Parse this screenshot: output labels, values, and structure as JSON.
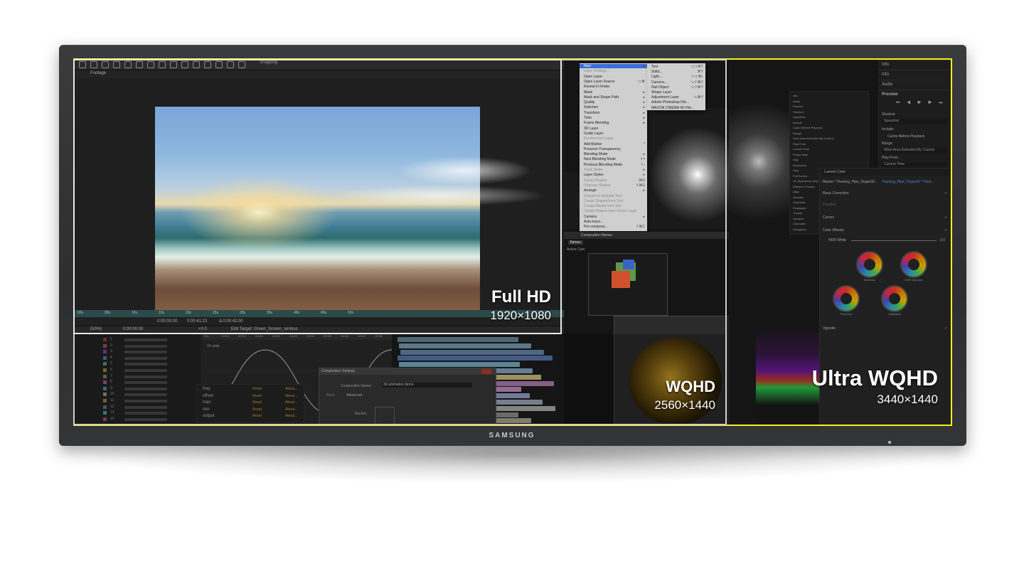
{
  "brand": "SAMSUNG",
  "resolutions": [
    {
      "title": "Full HD",
      "size": "1920×1080",
      "frame_color": "#e8e8e8"
    },
    {
      "title": "WQHD",
      "size": "2560×1440",
      "frame_color": "#cfcfcf"
    },
    {
      "title": "Ultra WQHD",
      "size": "3440×1440",
      "frame_color": "#f3f01e"
    }
  ],
  "ae": {
    "snapping": "Snapping",
    "footage_tab": "Footage",
    "ruler_ticks": [
      "00s",
      "05s",
      "10s",
      "15s",
      "20s",
      "25s",
      "30s",
      "35s",
      "40s",
      "45s",
      "50s"
    ],
    "timecodes": [
      "0:00:00:00",
      "0:00:41:23",
      "Δ 0:00:42:00"
    ],
    "zoom": "(50%)",
    "current_time": "0:00:00:00",
    "exposure": "+0.0",
    "edit_target": "Edit Target: Green_Screen_serious",
    "graph_label": "10 units",
    "graph_ticks": [
      "00s",
      "00015",
      "00010",
      "00015",
      "00020",
      "00025",
      "00030",
      "00035",
      "00040",
      "00045",
      "00050"
    ],
    "layer_numbers": [
      "1",
      "2",
      "3",
      "4",
      "5",
      "6",
      "7",
      "8",
      "9",
      "10",
      "11",
      "12",
      "13",
      "14"
    ],
    "fx_items": [
      {
        "name": "freq",
        "reset": "Reset",
        "about": "About..."
      },
      {
        "name": "offset",
        "reset": "Reset",
        "about": "About..."
      },
      {
        "name": "max",
        "reset": "Reset",
        "about": "About..."
      },
      {
        "name": "min",
        "reset": "Reset",
        "about": "About..."
      },
      {
        "name": "output",
        "reset": "Reset",
        "about": "About..."
      }
    ],
    "comp_dialog": {
      "title": "Composition Settings",
      "name_label": "Composition Name:",
      "name_value": "3d animation demo",
      "tab_basic": "Basic",
      "tab_advanced": "Advanced",
      "anchor_label": "Anchor:"
    }
  },
  "layer_menu": {
    "items": [
      {
        "label": "New",
        "shortcut": "▸",
        "state": "highlight"
      },
      {
        "label": "Layer Settings...",
        "shortcut": "",
        "state": "disabled"
      },
      {
        "label": "Open Layer",
        "shortcut": "",
        "state": "normal"
      },
      {
        "label": "Open Layer Source",
        "shortcut": "⌥⌘",
        "state": "normal"
      },
      {
        "label": "Reveal in Finder",
        "shortcut": "",
        "state": "normal"
      },
      {
        "label": "Mask",
        "shortcut": "▸",
        "state": "normal"
      },
      {
        "label": "Mask and Shape Path",
        "shortcut": "▸",
        "state": "normal"
      },
      {
        "label": "Quality",
        "shortcut": "▸",
        "state": "normal"
      },
      {
        "label": "Switches",
        "shortcut": "▸",
        "state": "normal"
      },
      {
        "label": "Transform",
        "shortcut": "▸",
        "state": "normal"
      },
      {
        "label": "Time",
        "shortcut": "▸",
        "state": "normal"
      },
      {
        "label": "Frame Blending",
        "shortcut": "▸",
        "state": "normal"
      },
      {
        "label": "3D Layer",
        "shortcut": "",
        "state": "normal"
      },
      {
        "label": "Guide Layer",
        "shortcut": "",
        "state": "normal"
      },
      {
        "label": "Environment Layer",
        "shortcut": "",
        "state": "disabled"
      },
      {
        "label": "Add Marker",
        "shortcut": "*",
        "state": "normal"
      },
      {
        "label": "Preserve Transparency",
        "shortcut": "",
        "state": "normal"
      },
      {
        "label": "Blending Mode",
        "shortcut": "▸",
        "state": "normal"
      },
      {
        "label": "Next Blending Mode",
        "shortcut": "⇧=",
        "state": "normal"
      },
      {
        "label": "Previous Blending Mode",
        "shortcut": "⇧-",
        "state": "normal"
      },
      {
        "label": "Track Matte",
        "shortcut": "▸",
        "state": "disabled"
      },
      {
        "label": "Layer Styles",
        "shortcut": "▸",
        "state": "normal"
      },
      {
        "label": "Group Shapes",
        "shortcut": "⌘G",
        "state": "disabled"
      },
      {
        "label": "Ungroup Shapes",
        "shortcut": "⇧⌘G",
        "state": "disabled"
      },
      {
        "label": "Arrange",
        "shortcut": "▸",
        "state": "normal"
      },
      {
        "label": "Convert to Editable Text",
        "shortcut": "",
        "state": "disabled"
      },
      {
        "label": "Create Shapes from Text",
        "shortcut": "",
        "state": "disabled"
      },
      {
        "label": "Create Masks from Text",
        "shortcut": "",
        "state": "disabled"
      },
      {
        "label": "Create Shapes from Vector Layer",
        "shortcut": "",
        "state": "disabled"
      },
      {
        "label": "Camera",
        "shortcut": "▸",
        "state": "normal"
      },
      {
        "label": "Auto-trace...",
        "shortcut": "",
        "state": "normal"
      },
      {
        "label": "Pre-compose...",
        "shortcut": "⇧⌘C",
        "state": "normal"
      }
    ],
    "submenu": [
      {
        "label": "Text",
        "shortcut": "⌥⇧⌘T"
      },
      {
        "label": "Solid...",
        "shortcut": "⌘Y"
      },
      {
        "label": "Light...",
        "shortcut": "⌥⇧⌘L"
      },
      {
        "label": "Camera...",
        "shortcut": "⌥⇧⌘C"
      },
      {
        "label": "Null Object",
        "shortcut": "⌥⇧⌘Y"
      },
      {
        "label": "Shape Layer",
        "shortcut": ""
      },
      {
        "label": "Adjustment Layer",
        "shortcut": "⌥⌘Y"
      },
      {
        "label": "Adobe Photoshop File...",
        "shortcut": ""
      },
      {
        "label": "MAXON CINEMA 4D File...",
        "shortcut": ""
      }
    ]
  },
  "mid_panels": {
    "composition_label": "Composition flames",
    "flames_tab": "flames",
    "active_camera": "Active Cam"
  },
  "right_panels": {
    "info_rows": [
      "Info",
      "Info",
      "Audio"
    ],
    "preview_title": "Preview",
    "shortcut_label": "Shortcut",
    "shortcut_value": "Spacebar",
    "include_label": "Include:",
    "cache_label": "Cache Before Playback",
    "range_label": "Range",
    "range_value": "Work Area Extended By Current",
    "play_from_label": "Play From",
    "play_from_value": "Current Time",
    "effects_rows": [
      "Info",
      "Audio",
      "Preview",
      "Shortcut",
      "Spacebar",
      "Include",
      "Cache Before Playback",
      "Range",
      "Work Area Extended By Current",
      "Play From",
      "Current Time",
      "Frame Rate",
      "Skip",
      "Resolution",
      "Auto",
      "Full Screen",
      "On (Spacebar) Stop",
      "Effects & Presets",
      "Align",
      "Libraries",
      "Character",
      "Paragraph",
      "Tracker",
      "Libraries",
      "Character",
      "Paragraph"
    ],
    "lumetri": {
      "title": "Lumetri Color",
      "master": "Master * Flaming_Pipe_Organ00...",
      "clip": "Flaming_Pipe_Organ00 * Flam...",
      "basic_correction": "Basic Correction",
      "creative": "Creative",
      "curves": "Curves",
      "color_wheels": "Color Wheels",
      "hdr_white": "HDR White",
      "hdr_value": "100",
      "wheels": [
        "Midtones",
        "HDR Specular",
        "Shadows",
        "Highlights"
      ],
      "vignette": "Vignette"
    }
  }
}
